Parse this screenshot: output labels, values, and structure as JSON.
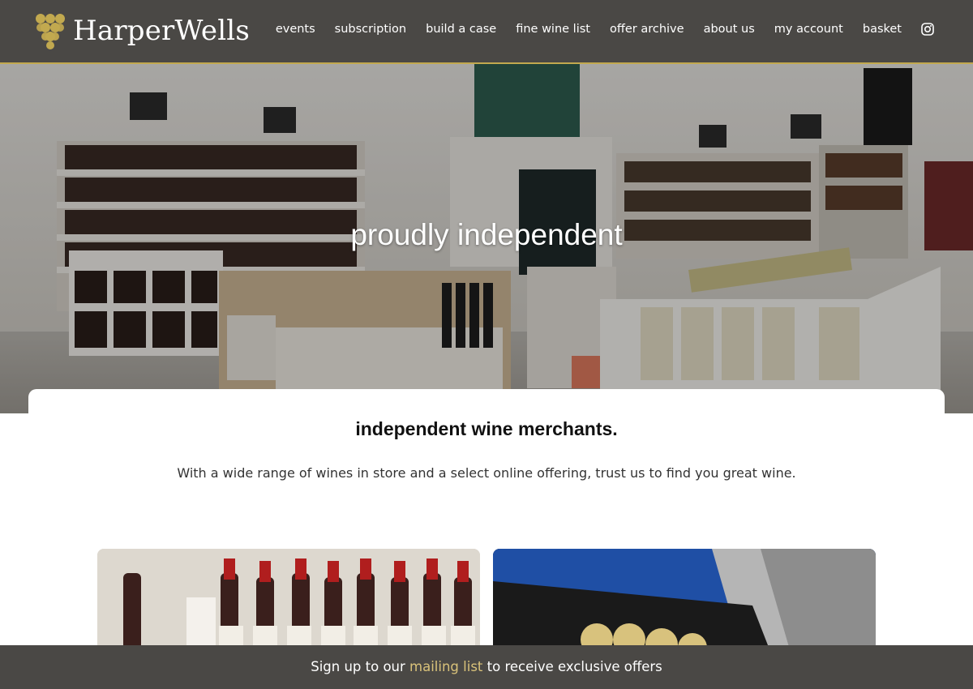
{
  "brand": {
    "name": "HarperWells",
    "accent": "#c2a94f",
    "header_bg": "#4a4845"
  },
  "nav": {
    "items": [
      {
        "label": "events"
      },
      {
        "label": "subscription"
      },
      {
        "label": "build a case"
      },
      {
        "label": "fine wine list"
      },
      {
        "label": "offer archive"
      },
      {
        "label": "about us"
      },
      {
        "label": "my account"
      },
      {
        "label": "basket"
      }
    ],
    "social_icon": "instagram-icon"
  },
  "hero": {
    "title": "proudly independent",
    "image": "wine-shop-interior-photo"
  },
  "intro": {
    "heading": "independent wine merchants.",
    "text": "With a wide range of wines in store and a select online offering, trust us to find you great wine."
  },
  "tiles": [
    {
      "image": "wine-bottles-photo"
    },
    {
      "image": "shop-sign-photo"
    }
  ],
  "signup": {
    "before": "Sign up to our ",
    "link": "mailing list",
    "after": " to receive exclusive offers",
    "link_color": "#d9c27a"
  }
}
